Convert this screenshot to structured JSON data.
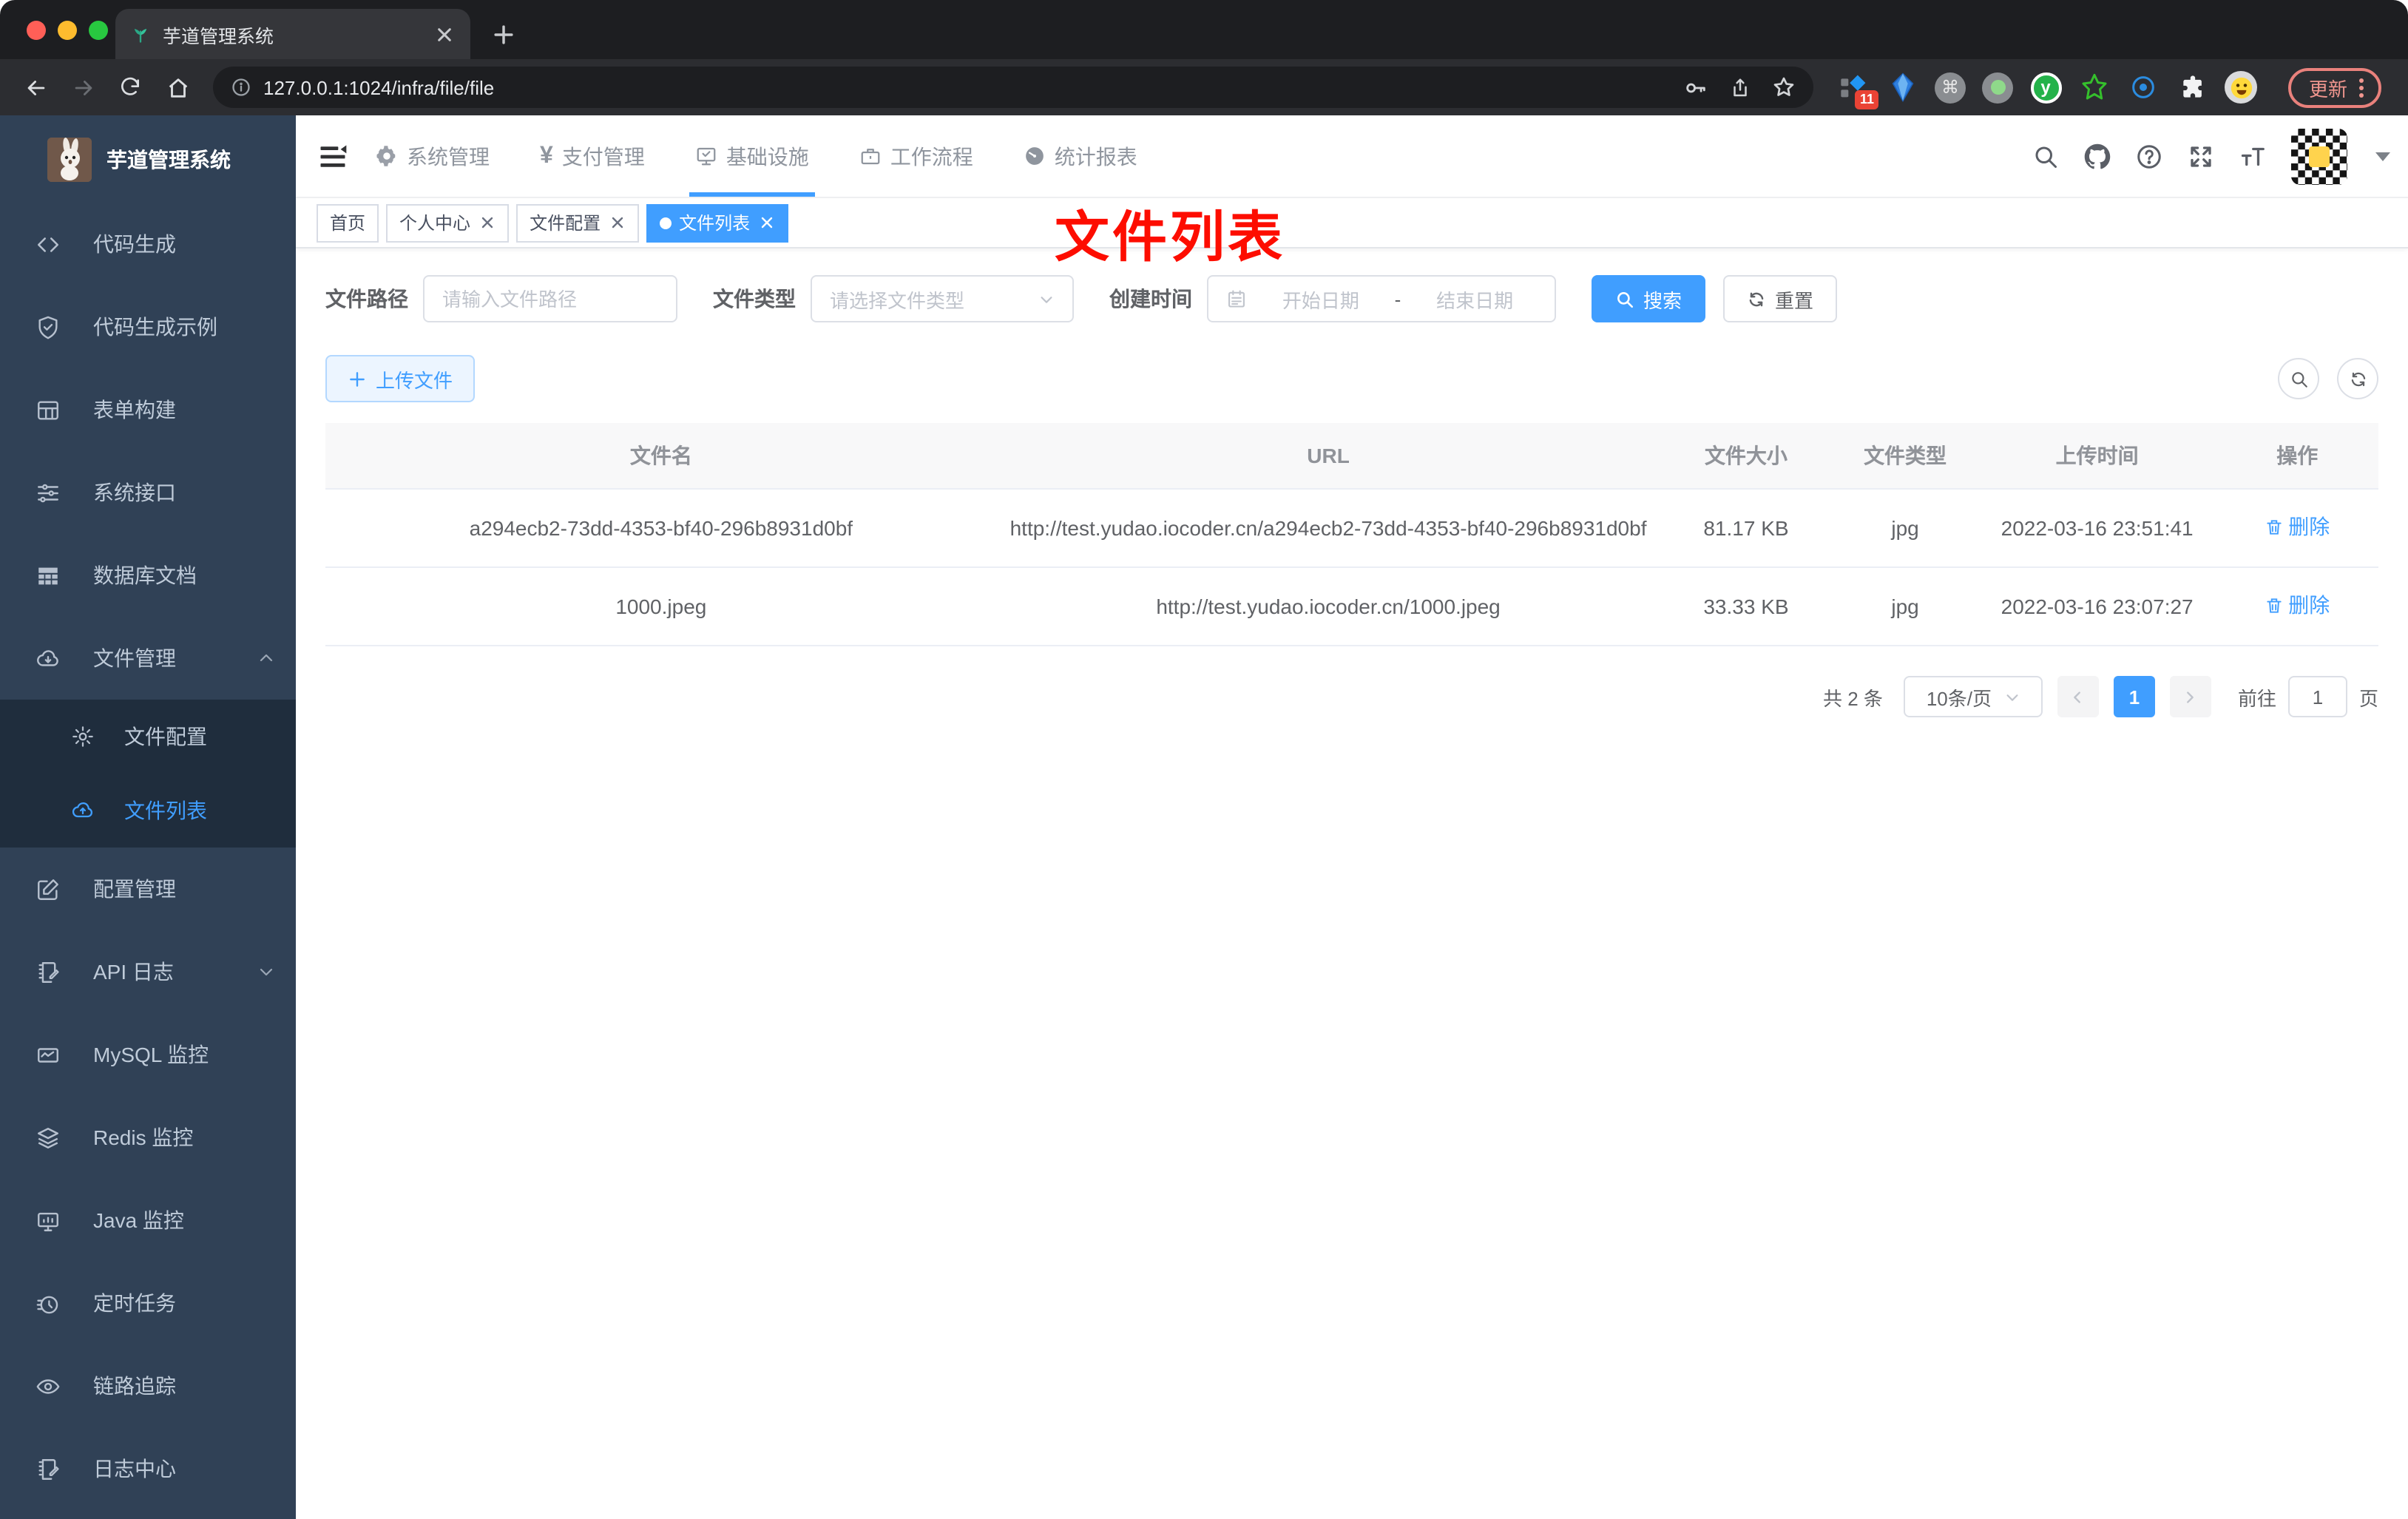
{
  "browser": {
    "tab_title": "芋道管理系统",
    "url": "127.0.0.1:1024/infra/file/file",
    "update_label": "更新",
    "extensions": {
      "badge_count": "11",
      "command_symbol": "⌘",
      "y_letter": "y"
    }
  },
  "sidebar": {
    "app_title": "芋道管理系统",
    "items": [
      {
        "label": "代码生成"
      },
      {
        "label": "代码生成示例"
      },
      {
        "label": "表单构建"
      },
      {
        "label": "系统接口"
      },
      {
        "label": "数据库文档"
      },
      {
        "label": "文件管理"
      },
      {
        "label": "配置管理"
      },
      {
        "label": "API 日志"
      },
      {
        "label": "MySQL 监控"
      },
      {
        "label": "Redis 监控"
      },
      {
        "label": "Java 监控"
      },
      {
        "label": "定时任务"
      },
      {
        "label": "链路追踪"
      },
      {
        "label": "日志中心"
      }
    ],
    "submenu": {
      "items": [
        {
          "label": "文件配置"
        },
        {
          "label": "文件列表"
        }
      ]
    }
  },
  "header": {
    "nav": [
      {
        "label": "系统管理"
      },
      {
        "label": "支付管理",
        "symbol": "¥"
      },
      {
        "label": "基础设施"
      },
      {
        "label": "工作流程"
      },
      {
        "label": "统计报表"
      }
    ]
  },
  "tags": {
    "items": [
      {
        "label": "首页"
      },
      {
        "label": "个人中心"
      },
      {
        "label": "文件配置"
      },
      {
        "label": "文件列表"
      }
    ]
  },
  "annotation": {
    "text": "文件列表"
  },
  "filters": {
    "path_label": "文件路径",
    "path_placeholder": "请输入文件路径",
    "type_label": "文件类型",
    "type_placeholder": "请选择文件类型",
    "date_label": "创建时间",
    "date_start_placeholder": "开始日期",
    "date_separator": "-",
    "date_end_placeholder": "结束日期",
    "search_label": "搜索",
    "reset_label": "重置"
  },
  "toolbar": {
    "upload_label": "上传文件"
  },
  "table": {
    "headers": [
      "文件名",
      "URL",
      "文件大小",
      "文件类型",
      "上传时间",
      "操作"
    ],
    "rows": [
      {
        "name": "a294ecb2-73dd-4353-bf40-296b8931d0bf",
        "url": "http://test.yudao.iocoder.cn/a294ecb2-73dd-4353-bf40-296b8931d0bf",
        "size": "81.17 KB",
        "type": "jpg",
        "time": "2022-03-16 23:51:41",
        "action": "删除"
      },
      {
        "name": "1000.jpeg",
        "url": "http://test.yudao.iocoder.cn/1000.jpeg",
        "size": "33.33 KB",
        "type": "jpg",
        "time": "2022-03-16 23:07:27",
        "action": "删除"
      }
    ]
  },
  "pagination": {
    "total": "共 2 条",
    "page_size": "10条/页",
    "current_page": "1",
    "goto_label": "前往",
    "goto_value": "1",
    "page_unit": "页"
  },
  "colors": {
    "accent": "#409eff",
    "sidebar_bg": "#304156",
    "submenu_bg": "#1f2d3d",
    "annotation_red": "#fd0d00"
  }
}
